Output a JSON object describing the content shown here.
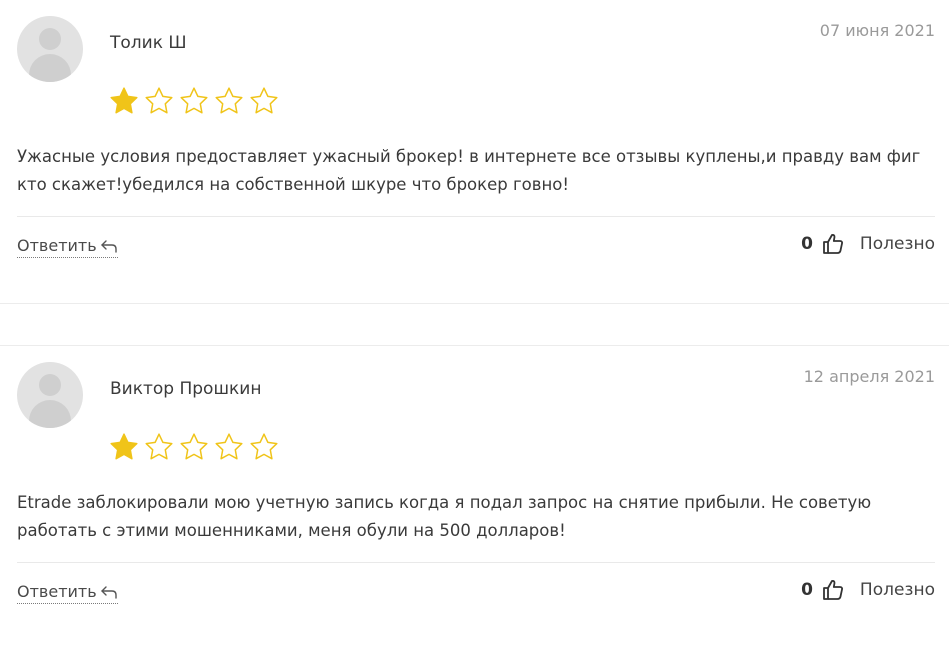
{
  "colors": {
    "star_filled": "#f0c419",
    "star_outline": "#f0c419",
    "text": "#3a3a3a",
    "date": "#9a9a9a",
    "divider": "#e9e9e9"
  },
  "reviews": [
    {
      "author": "Толик Ш",
      "date": "07 июня 2021",
      "rating": 1,
      "rating_max": 5,
      "text": "Ужасные условия предоставляет ужасный брокер! в интернете все отзывы куплены,и правду вам фиг кто скажет!убедился на собственной шкуре что брокер говно!",
      "reply_label": "Ответить",
      "reply_icon": "reply-arrow-icon",
      "useful_count": "0",
      "useful_icon": "thumbs-up-icon",
      "useful_label": "Полезно"
    },
    {
      "author": "Виктор Прошкин",
      "date": "12 апреля 2021",
      "rating": 1,
      "rating_max": 5,
      "text": "Etrade заблокировали мою учетную запись когда я подал запрос на снятие прибыли. Не советую работать с этими мошенниками, меня обули на 500 долларов!",
      "reply_label": "Ответить",
      "reply_icon": "reply-arrow-icon",
      "useful_count": "0",
      "useful_icon": "thumbs-up-icon",
      "useful_label": "Полезно"
    }
  ]
}
